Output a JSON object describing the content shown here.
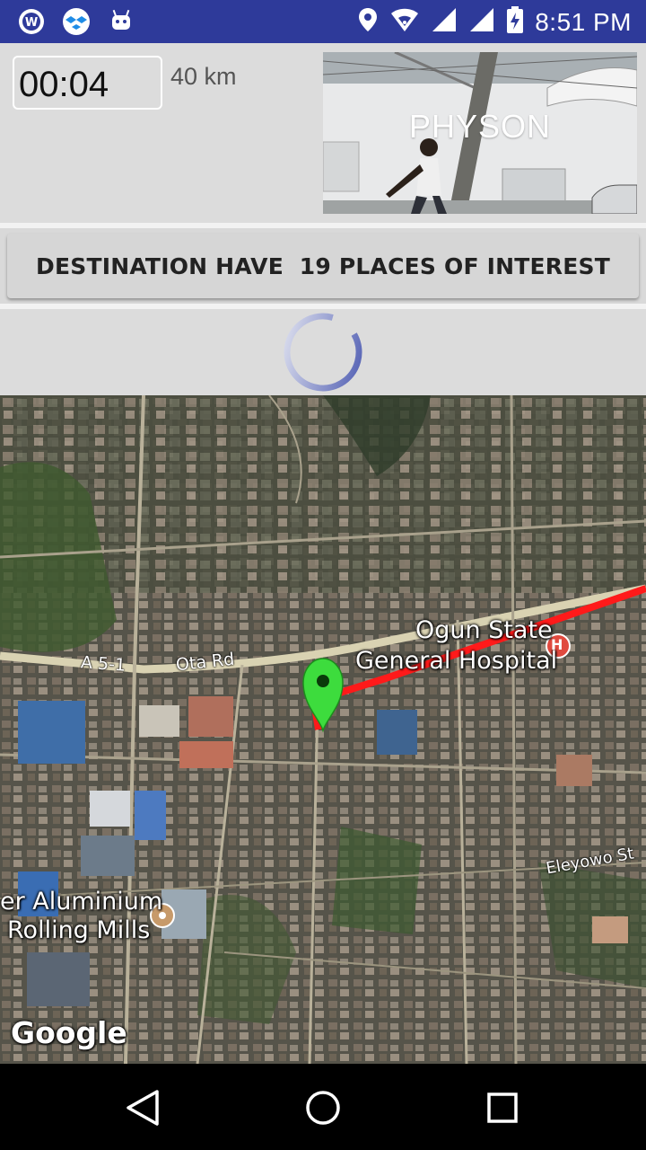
{
  "status_bar": {
    "time": "8:51 PM",
    "left_icons": [
      "whatsapp-icon",
      "dropbox-icon",
      "android-icon"
    ],
    "right_icons": [
      "location-icon",
      "wifi-icon",
      "signal-icon",
      "signal-icon",
      "battery-charging-icon"
    ]
  },
  "top_panel": {
    "timer": "00:04",
    "distance": "40 km",
    "photo_label": "PHYSON"
  },
  "destination_button": {
    "label": "DESTINATION HAVE  19 PLACES OF INTEREST"
  },
  "map": {
    "hospital_label_line1": "Ogun State",
    "hospital_label_line2": "General Hospital",
    "hospital_badge": "H",
    "road_a51": "A 5-1",
    "road_ota": "Ota Rd",
    "road_eleyowo": "Eleyowo St",
    "aluminium_line1": "er Aluminium",
    "aluminium_line2": "Rolling Mills",
    "google_logo": "Google",
    "route_color": "#ff1a1a",
    "marker_color": "#3ddc3d"
  },
  "nav_bar": {
    "buttons": [
      "back-icon",
      "home-icon",
      "recents-icon"
    ]
  }
}
